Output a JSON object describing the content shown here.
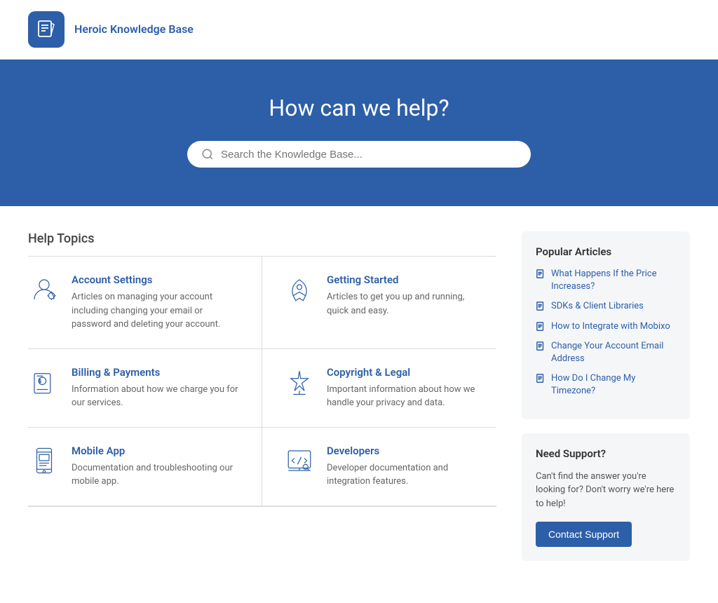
{
  "header": {
    "brand": "Heroic Knowledge Base",
    "logo_alt": "heroic-kb-logo"
  },
  "hero": {
    "title": "How can we help?",
    "search_placeholder": "Search the Knowledge Base..."
  },
  "main": {
    "section_title": "Help Topics",
    "topics": [
      {
        "id": "account-settings",
        "name": "Account Settings",
        "description": "Articles on managing your account including changing your email or password and deleting your account.",
        "icon": "account"
      },
      {
        "id": "getting-started",
        "name": "Getting Started",
        "description": "Articles to get you up and running, quick and easy.",
        "icon": "rocket"
      },
      {
        "id": "billing-payments",
        "name": "Billing & Payments",
        "description": "Information about how we charge you for our services.",
        "icon": "billing"
      },
      {
        "id": "copyright-legal",
        "name": "Copyright & Legal",
        "description": "Important information about how we handle your privacy and data.",
        "icon": "legal"
      },
      {
        "id": "mobile-app",
        "name": "Mobile App",
        "description": "Documentation and troubleshooting our mobile app.",
        "icon": "mobile"
      },
      {
        "id": "developers",
        "name": "Developers",
        "description": "Developer documentation and integration features.",
        "icon": "developer"
      }
    ]
  },
  "sidebar": {
    "popular_articles": {
      "title": "Popular Articles",
      "articles": [
        "What Happens If the Price Increases?",
        "SDKs & Client Libraries",
        "How to Integrate with Mobixo",
        "Change Your Account Email Address",
        "How Do I Change My Timezone?"
      ]
    },
    "need_support": {
      "title": "Need Support?",
      "description": "Can't find the answer you're looking for? Don't worry we're here to help!",
      "button_label": "Contact Support"
    }
  }
}
